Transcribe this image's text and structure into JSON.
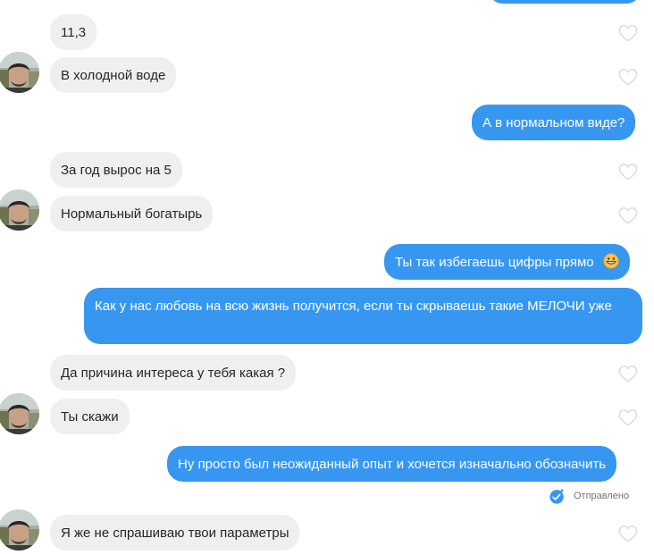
{
  "messages": [
    {
      "id": "m1",
      "side": "in",
      "text": "11,3"
    },
    {
      "id": "m2",
      "side": "in",
      "text": "В холодной воде"
    },
    {
      "id": "m3",
      "side": "out",
      "text": "А в нормальном виде?"
    },
    {
      "id": "m4",
      "side": "in",
      "text": "За год вырос на 5"
    },
    {
      "id": "m5",
      "side": "in",
      "text": "Нормальный богатырь"
    },
    {
      "id": "m6",
      "side": "out",
      "text": "Ты так избегаешь цифры прямо",
      "emoji": "grinning-face-emoji"
    },
    {
      "id": "m7",
      "side": "out",
      "text": "Как у нас любовь на всю жизнь получится, если ты скрываешь такие МЕЛОЧИ уже"
    },
    {
      "id": "m8",
      "side": "in",
      "text": "Да причина интереса у тебя какая ?"
    },
    {
      "id": "m9",
      "side": "in",
      "text": "Ты скажи"
    },
    {
      "id": "m10",
      "side": "out",
      "text": "Ну просто был неожиданный опыт и хочется изначально обозначить"
    },
    {
      "id": "m11",
      "side": "in",
      "text": "Я же не спрашиваю твои параметры"
    }
  ],
  "status": {
    "label": "Отправлено",
    "icon": "sent-check-icon"
  },
  "icons": {
    "like": "heart-icon",
    "avatar": "contact-avatar"
  },
  "colors": {
    "incoming_bubble": "#efefef",
    "outgoing_bubble": "#3797f0",
    "status_text": "#737373"
  }
}
